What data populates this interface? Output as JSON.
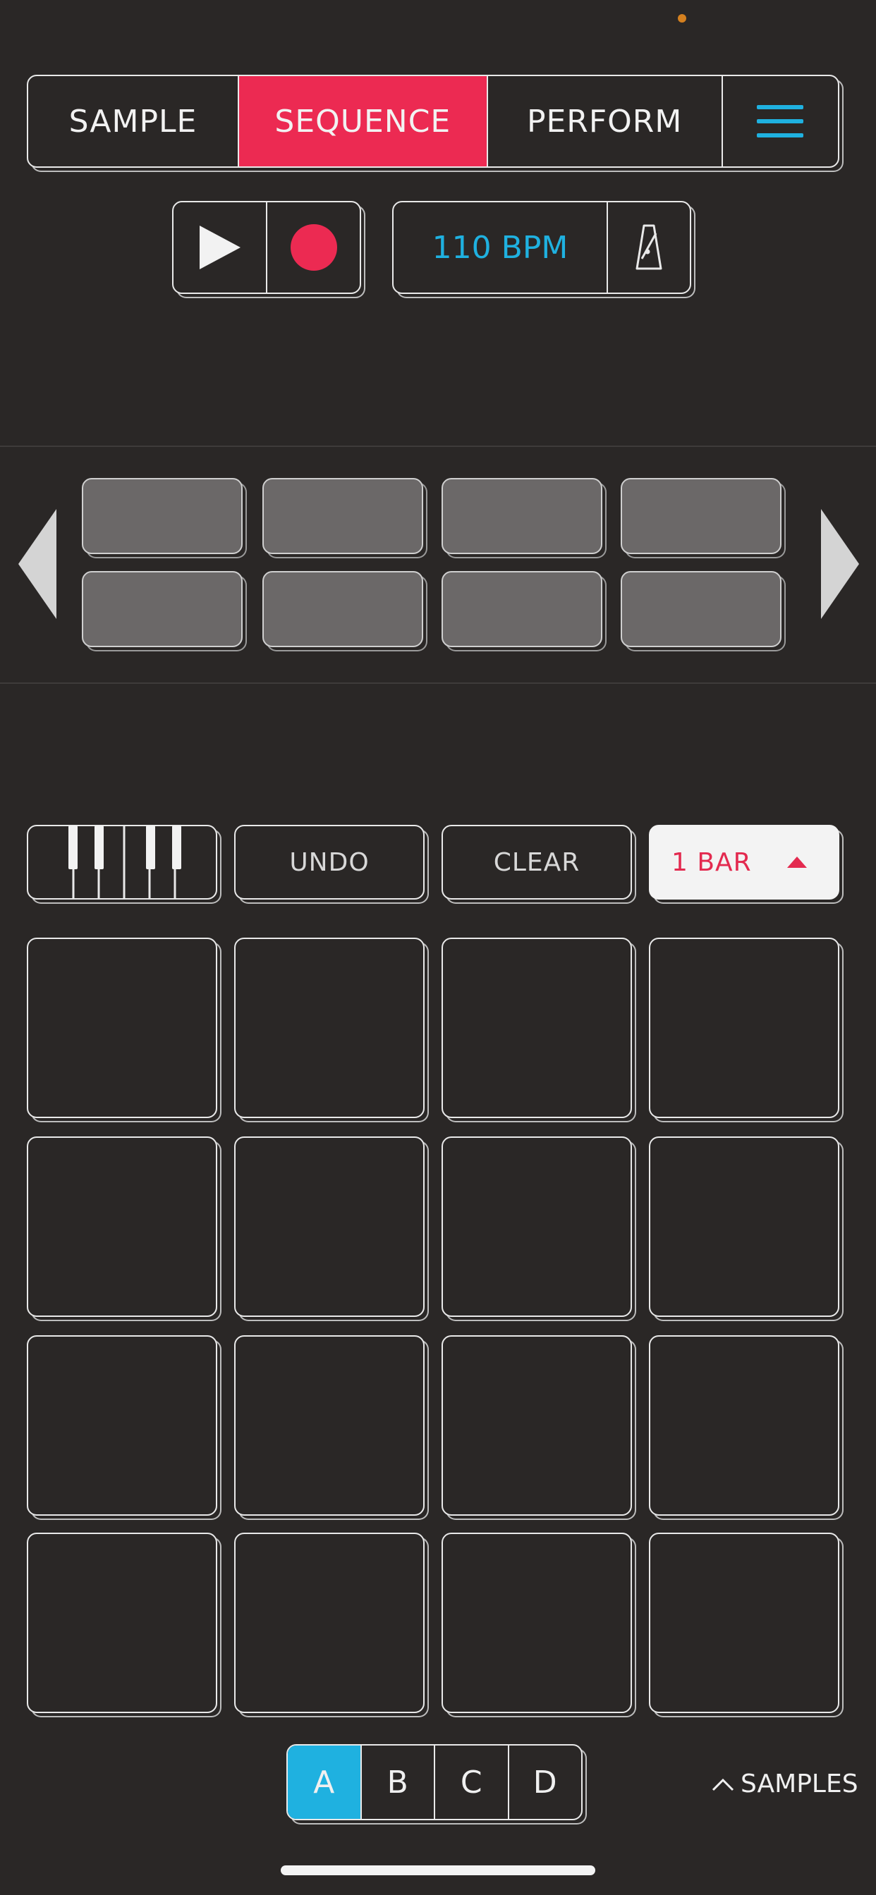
{
  "status_bar": {
    "indicator_color": "#d4801f"
  },
  "colors": {
    "accent_red": "#ec2a52",
    "accent_blue": "#1fb1e0",
    "background": "#2a2726"
  },
  "tabs": [
    {
      "label": "SAMPLE"
    },
    {
      "label": "SEQUENCE",
      "active": true
    },
    {
      "label": "PERFORM"
    }
  ],
  "menu": {
    "icon": "hamburger-menu-icon"
  },
  "transport": {
    "play_icon": "play-icon",
    "record_icon": "record-icon"
  },
  "tempo": {
    "bpm_label": "110 BPM",
    "metronome_icon": "metronome-icon"
  },
  "pattern_nav": {
    "prev_icon": "chevron-left-icon",
    "next_icon": "chevron-right-icon",
    "slot_count": 8
  },
  "controls": {
    "keyboard_icon": "piano-keyboard-icon",
    "undo_label": "UNDO",
    "clear_label": "CLEAR",
    "bar_label": "1 BAR",
    "bar_arrow_icon": "triangle-up-icon"
  },
  "pads": {
    "rows": 4,
    "cols": 4
  },
  "banks": [
    {
      "label": "A",
      "active": true
    },
    {
      "label": "B"
    },
    {
      "label": "C"
    },
    {
      "label": "D"
    }
  ],
  "samples_link": {
    "label": "SAMPLES",
    "icon": "chevron-up-icon"
  }
}
